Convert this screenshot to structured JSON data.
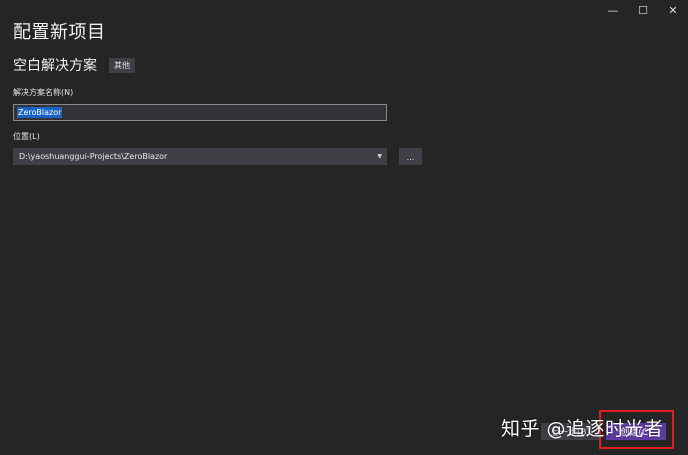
{
  "window": {
    "minimize_icon": "minimize-icon",
    "maximize_icon": "maximize-icon",
    "close_icon": "close-icon"
  },
  "page": {
    "title": "配置新项目"
  },
  "template": {
    "name": "空白解决方案",
    "tag": "其他"
  },
  "form": {
    "solution_name_label": "解决方案名称(N)",
    "solution_name_value": "ZeroBlazor",
    "location_label": "位置(L)",
    "location_value": "D:\\yaoshuanggui-Projects\\ZeroBlazor",
    "browse_label": "..."
  },
  "footer": {
    "back_label": "上一步(B)",
    "create_label": "创建(C)"
  },
  "watermark": {
    "text": "知乎 @追逐时光者"
  },
  "colors": {
    "background": "#252526",
    "accent": "#5e3ba3",
    "selection": "#1a64c7",
    "highlight_border": "#e21d1d"
  }
}
